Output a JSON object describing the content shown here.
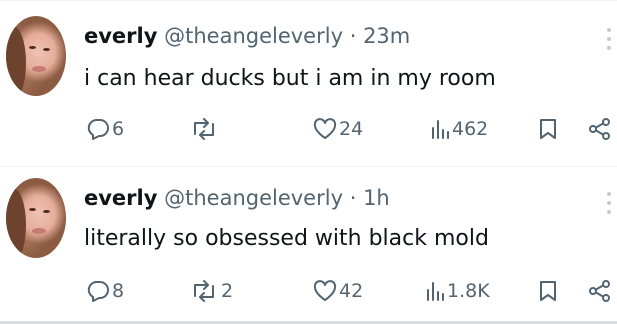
{
  "tweets": [
    {
      "name": "everly",
      "handle": "@theangeleverly",
      "separator": "·",
      "time": "23m",
      "text": "i can hear ducks but i am in my room",
      "replies": "6",
      "reposts": "",
      "likes": "24",
      "views": "462"
    },
    {
      "name": "everly",
      "handle": "@theangeleverly",
      "separator": "·",
      "time": "1h",
      "text": "literally so obsessed with black mold",
      "replies": "8",
      "reposts": "2",
      "likes": "42",
      "views": "1.8K"
    }
  ],
  "icons": [
    "reply-icon",
    "repost-icon",
    "like-icon",
    "views-icon",
    "bookmark-icon",
    "share-icon",
    "more-icon"
  ],
  "colors": {
    "text": "#0f1419",
    "muted": "#536471",
    "divider": "#eff3f4"
  }
}
